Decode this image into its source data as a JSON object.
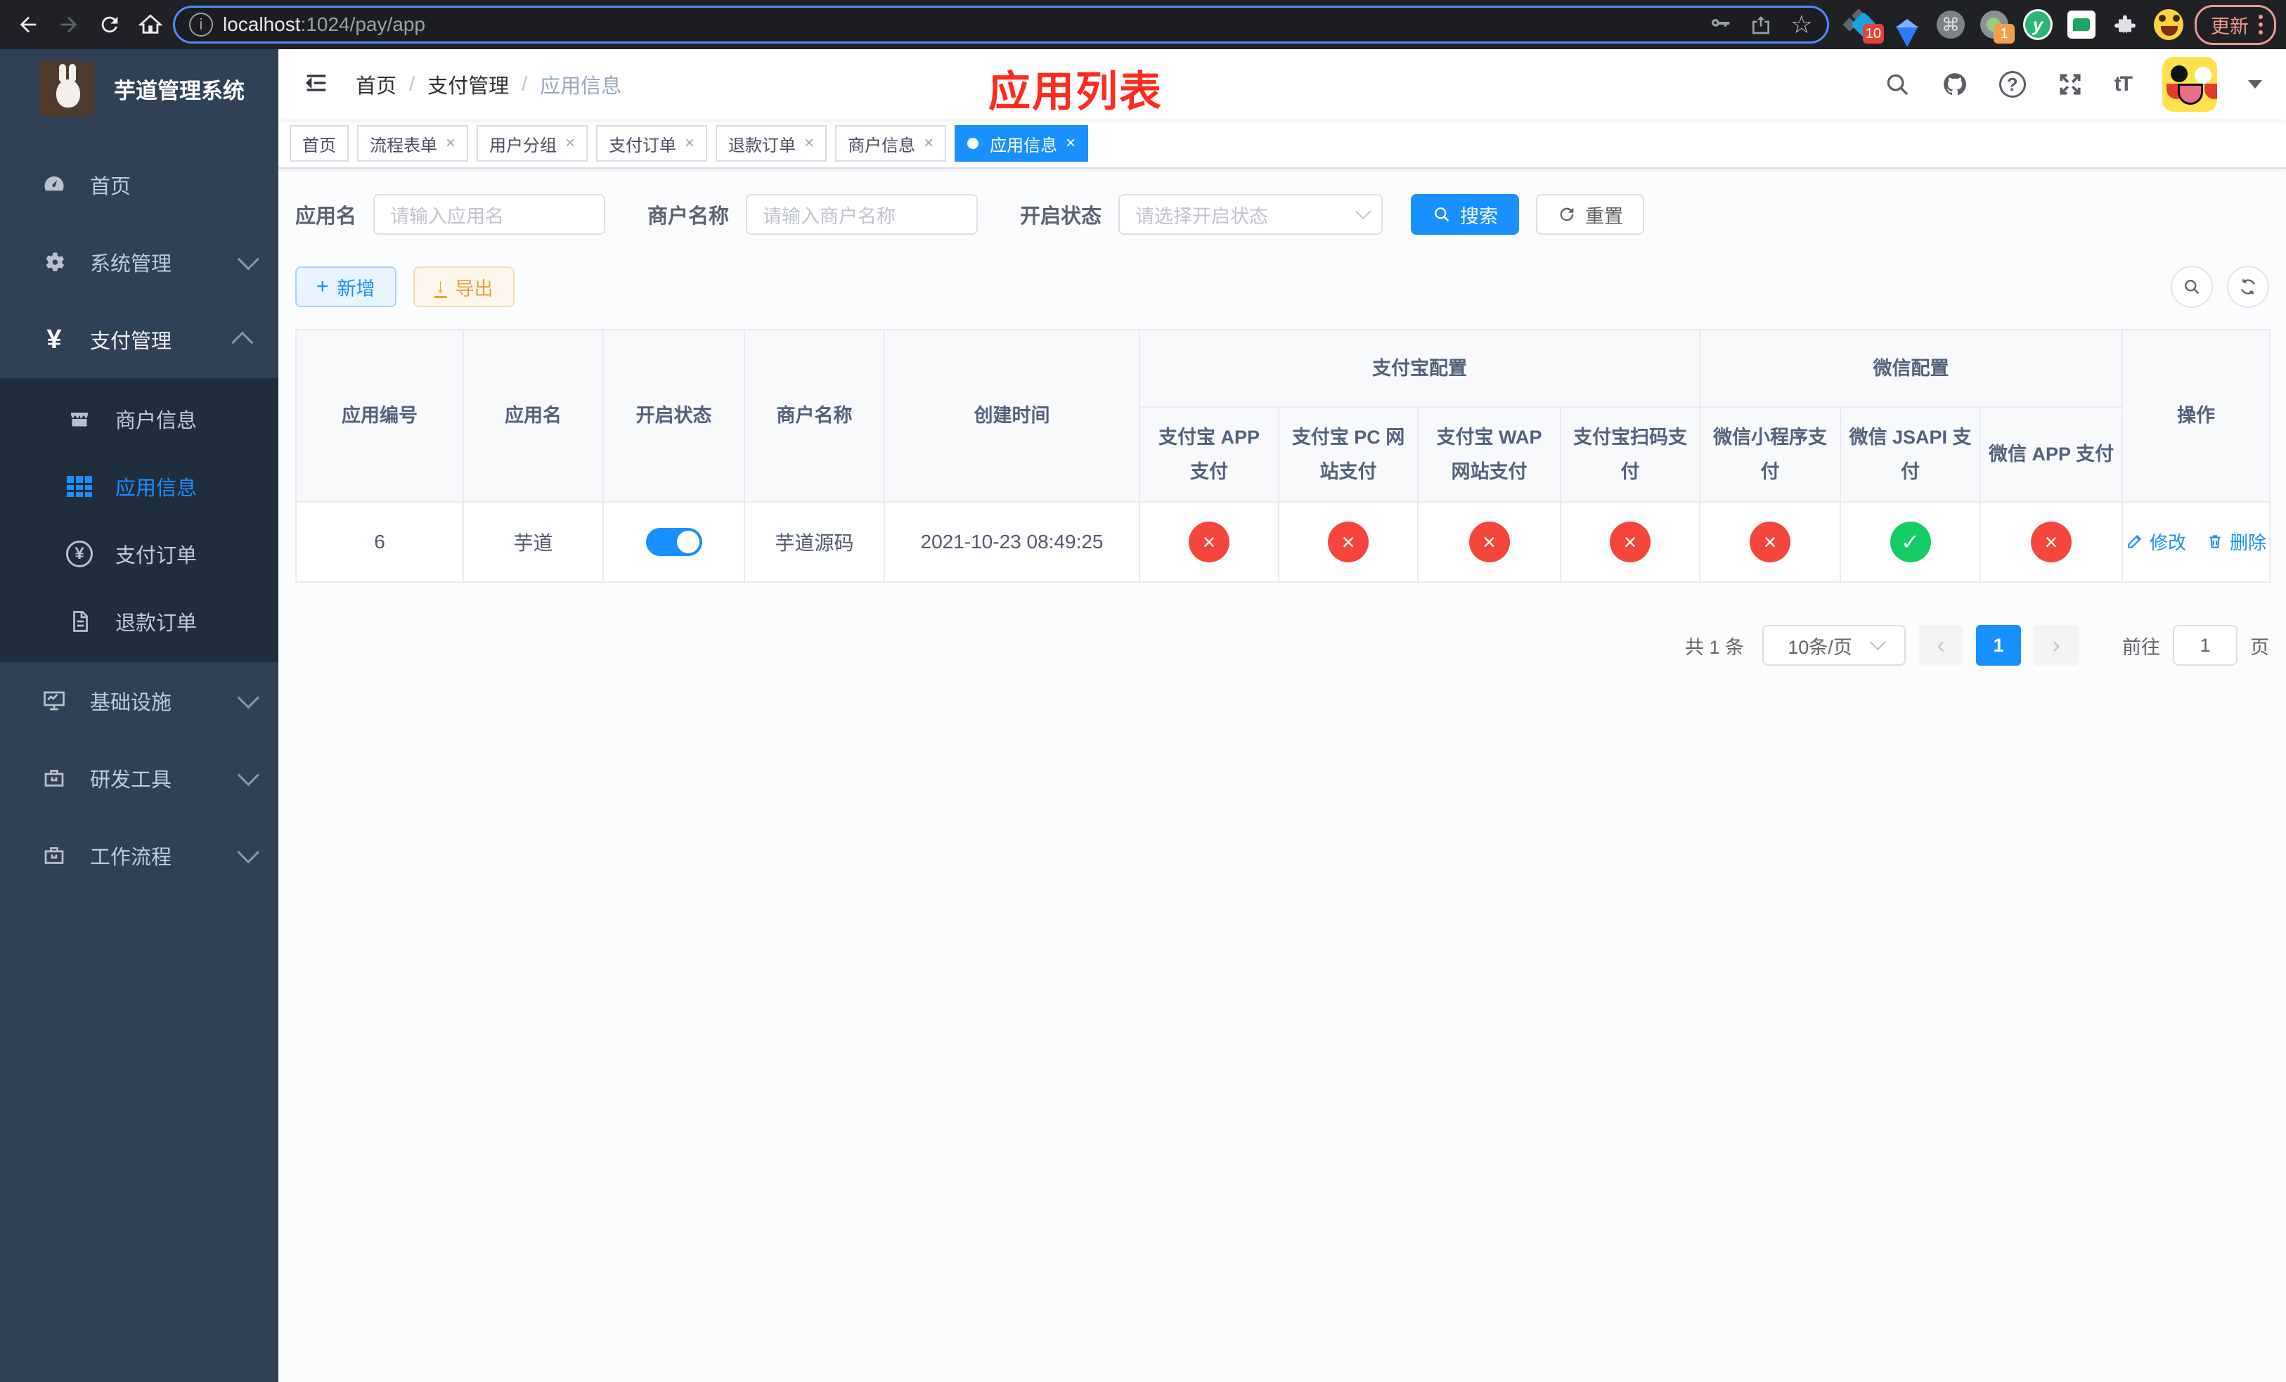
{
  "colors": {
    "primary": "#1890ff",
    "success": "#13ce66",
    "danger": "#f5463d",
    "warning": "#e6a23c",
    "title_red": "#fe2c1e",
    "sidebar_bg": "#304156",
    "submenu_bg": "#1f2d3d"
  },
  "browser": {
    "url_host": "localhost",
    "url_path": ":1024/pay/app",
    "update_label": "更新",
    "ext_badge_blocks": "10",
    "ext_badge_dot": "1",
    "cmd_glyph": "⌘",
    "y_glyph": "y",
    "star_glyph": "☆",
    "info_glyph": "i"
  },
  "sidebar": {
    "title": "芋道管理系统",
    "items": {
      "home": "首页",
      "system": "系统管理",
      "pay": "支付管理",
      "infra": "基础设施",
      "devtool": "研发工具",
      "workflow": "工作流程"
    },
    "pay_children": {
      "merchant": "商户信息",
      "app": "应用信息",
      "order": "支付订单",
      "refund": "退款订单"
    }
  },
  "navbar": {
    "breadcrumb": [
      "首页",
      "支付管理",
      "应用信息"
    ],
    "separator": "/",
    "annotation": "应用列表",
    "font_icon": "tT",
    "help_glyph": "?"
  },
  "tabs": [
    {
      "label": "首页",
      "closable": false
    },
    {
      "label": "流程表单",
      "closable": true
    },
    {
      "label": "用户分组",
      "closable": true
    },
    {
      "label": "支付订单",
      "closable": true
    },
    {
      "label": "退款订单",
      "closable": true
    },
    {
      "label": "商户信息",
      "closable": true
    },
    {
      "label": "应用信息",
      "closable": true,
      "active": true
    }
  ],
  "glyphs": {
    "close": "×",
    "plus": "+",
    "download": "↓"
  },
  "filters": {
    "app_name_label": "应用名",
    "app_name_placeholder": "请输入应用名",
    "merchant_label": "商户名称",
    "merchant_placeholder": "请输入商户名称",
    "status_label": "开启状态",
    "status_placeholder": "请选择开启状态",
    "search_label": "搜索",
    "reset_label": "重置"
  },
  "toolbar": {
    "add_label": "新增",
    "export_label": "导出"
  },
  "table": {
    "columns": [
      "应用编号",
      "应用名",
      "开启状态",
      "商户名称",
      "创建时间"
    ],
    "groups": {
      "alipay": {
        "label": "支付宝配置",
        "children": [
          "支付宝 APP 支付",
          "支付宝 PC 网站支付",
          "支付宝 WAP 网站支付",
          "支付宝扫码支付"
        ]
      },
      "wechat": {
        "label": "微信配置",
        "children": [
          "微信小程序支付",
          "微信 JSAPI 支付",
          "微信 APP 支付"
        ]
      }
    },
    "op_label": "操作",
    "row": {
      "id": "6",
      "name": "芋道",
      "enabled": "on",
      "merchant": "芋道源码",
      "created": "2021-10-23 08:49:25",
      "channels": [
        {
          "state": "fail",
          "glyph": "×"
        },
        {
          "state": "fail",
          "glyph": "×"
        },
        {
          "state": "fail",
          "glyph": "×"
        },
        {
          "state": "fail",
          "glyph": "×"
        },
        {
          "state": "fail",
          "glyph": "×"
        },
        {
          "state": "ok",
          "glyph": "✓"
        },
        {
          "state": "fail",
          "glyph": "×"
        }
      ],
      "edit_label": "修改",
      "delete_label": "删除"
    }
  },
  "pagination": {
    "total": "共 1 条",
    "page_size": "10条/页",
    "prev": "‹",
    "next": "›",
    "current": "1",
    "goto_prefix": "前往",
    "goto_value": "1",
    "goto_suffix": "页"
  }
}
